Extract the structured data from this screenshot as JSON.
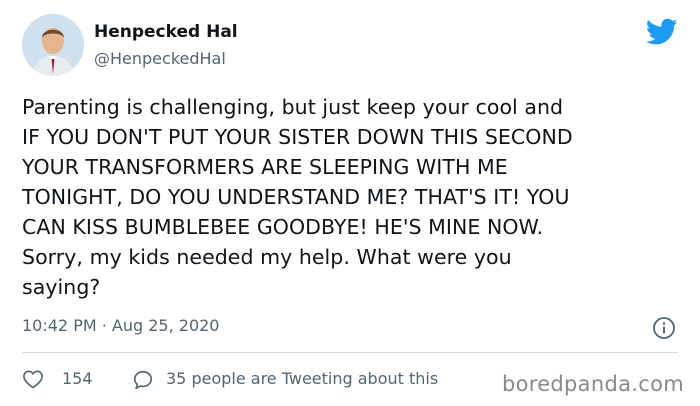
{
  "tweet": {
    "author_name": "Henpecked Hal",
    "author_handle": "@HenpeckedHal",
    "text_lines": [
      "Parenting is challenging, but just keep your cool and",
      "IF YOU DON'T PUT YOUR SISTER DOWN THIS SECOND",
      "YOUR TRANSFORMERS ARE SLEEPING WITH ME",
      "TONIGHT, DO YOU UNDERSTAND ME? THAT'S IT! YOU",
      "CAN KISS BUMBLEBEE GOODBYE! HE'S MINE NOW.",
      "Sorry, my kids needed my help. What were you",
      "saying?"
    ],
    "timestamp": "10:42 PM · Aug 25, 2020",
    "likes": "154",
    "tweeting_about": "35 people are Tweeting about this"
  },
  "icons": {
    "brand": "twitter-bird-icon",
    "info": "info-icon",
    "like": "heart-icon",
    "reply": "speech-bubble-icon"
  },
  "colors": {
    "brand_blue": "#1d9bf0",
    "text_primary": "#0f1419",
    "text_secondary": "#536471",
    "divider": "#cfd9de"
  },
  "watermark": "boredpanda.com"
}
